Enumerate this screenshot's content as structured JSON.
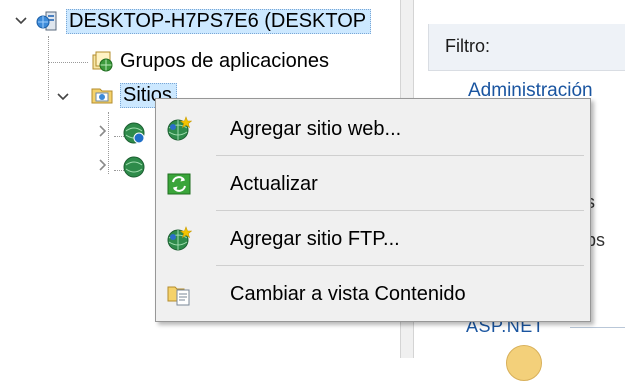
{
  "tree": {
    "server_label": "DESKTOP-H7PS7E6 (DESKTOP",
    "app_pools_label": "Grupos de aplicaciones",
    "sites_label": "Sitios"
  },
  "right_pane": {
    "filter_label": "Filtro:",
    "header_text": "Administración",
    "fragment_1": "s",
    "fragment_2": "ps",
    "aspnet_label": "ASP.NET"
  },
  "context_menu": {
    "items": [
      {
        "label": "Agregar sitio web...",
        "icon": "globe-add-icon"
      },
      {
        "label": "Actualizar",
        "icon": "refresh-icon"
      },
      {
        "label": "Agregar sitio FTP...",
        "icon": "globe-add-icon"
      },
      {
        "label": "Cambiar a vista Contenido",
        "icon": "content-view-icon"
      }
    ]
  },
  "colors": {
    "selection": "#cce8ff",
    "menu_background": "#f0f0f0",
    "link_blue": "#1a55a0"
  }
}
